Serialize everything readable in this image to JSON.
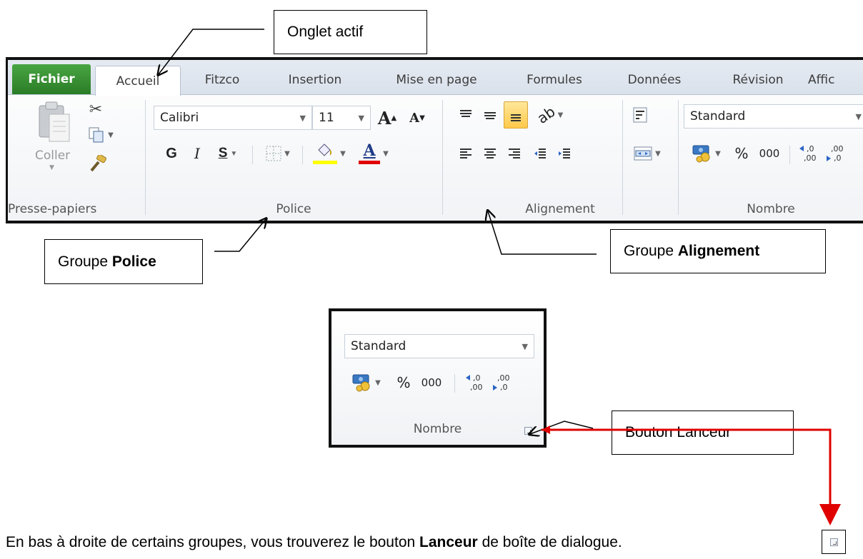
{
  "callouts": {
    "active_tab": "Onglet actif",
    "police_prefix": "Groupe ",
    "police_bold": "Police",
    "alignement_prefix": "Groupe ",
    "alignement_bold": "Alignement",
    "launcher": "Bouton Lanceur"
  },
  "tabs": [
    {
      "label": "Fichier",
      "active": false,
      "file": true
    },
    {
      "label": "Accueil",
      "active": true
    },
    {
      "label": "Fitzco"
    },
    {
      "label": "Insertion"
    },
    {
      "label": "Mise en page"
    },
    {
      "label": "Formules"
    },
    {
      "label": "Données"
    },
    {
      "label": "Révision"
    },
    {
      "label": "Affic"
    }
  ],
  "clipboard": {
    "paste_label": "Coller",
    "group_label": "Presse-papiers"
  },
  "font": {
    "font_name": "Calibri",
    "font_size": "11",
    "grow_label": "A",
    "shrink_label": "A",
    "bold_label": "G",
    "italic_label": "I",
    "underline_label": "S",
    "color_label": "A",
    "group_label": "Police"
  },
  "alignment": {
    "group_label": "Alignement"
  },
  "number": {
    "format_value": "Standard",
    "percent_label": "%",
    "thousands_label": "000",
    "dec_increase_label": ",0\n,00",
    "dec_decrease_label": ",00\n,0",
    "group_label": "Nombre"
  },
  "colors": {
    "file_tab": "#3f9a39",
    "highlight_yellow": "#ffff00",
    "font_red": "#e00000",
    "active_align": "#ffd56a",
    "arrow_red": "#e00000"
  },
  "footer": {
    "prefix": "En bas à droite de certains groupes, vous trouverez le bouton ",
    "bold": "Lanceur",
    "suffix": " de boîte de dialogue."
  }
}
